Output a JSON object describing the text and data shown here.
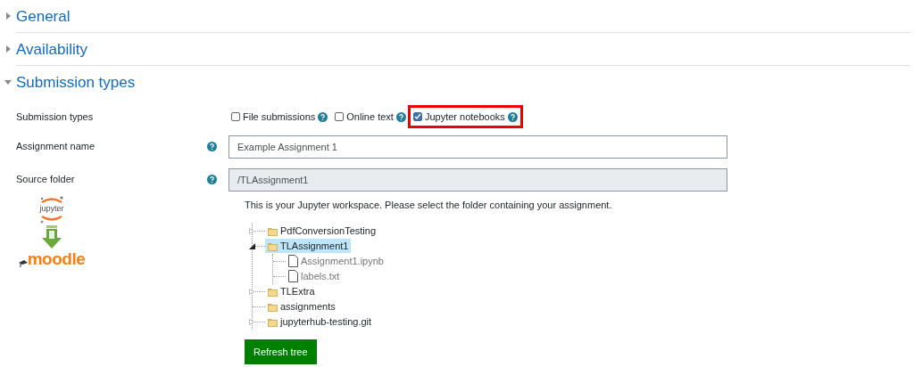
{
  "sections": [
    {
      "title": "General",
      "expanded": false
    },
    {
      "title": "Availability",
      "expanded": false
    },
    {
      "title": "Submission types",
      "expanded": true
    }
  ],
  "submission_types": {
    "label": "Submission types",
    "options": [
      {
        "label": "File submissions",
        "checked": false,
        "highlighted": false
      },
      {
        "label": "Online text",
        "checked": false,
        "highlighted": false
      },
      {
        "label": "Jupyter notebooks",
        "checked": true,
        "highlighted": true
      }
    ]
  },
  "assignment_name": {
    "label": "Assignment name",
    "value": "Example Assignment 1"
  },
  "source_folder": {
    "label": "Source folder",
    "value": "/TLAssignment1",
    "disabled": true
  },
  "logo": {
    "top_text": "jupyter",
    "bottom_text": "moodle"
  },
  "workspace_note": "This is your Jupyter workspace. Please select the folder containing your assignment.",
  "tree": [
    {
      "kind": "folder",
      "name": "PdfConversionTesting",
      "selected": false,
      "expanded": false
    },
    {
      "kind": "folder",
      "name": "TLAssignment1",
      "selected": true,
      "expanded": true,
      "children": [
        {
          "kind": "file",
          "name": "Assignment1.ipynb",
          "selected": false
        },
        {
          "kind": "file",
          "name": "labels.txt",
          "selected": false
        }
      ]
    },
    {
      "kind": "folder",
      "name": "TLExtra",
      "selected": false,
      "expanded": false
    },
    {
      "kind": "folder",
      "name": "assignments",
      "selected": false
    },
    {
      "kind": "folder",
      "name": "jupyterhub-testing.git",
      "selected": false,
      "expanded": false
    }
  ],
  "refresh_button": "Refresh tree"
}
